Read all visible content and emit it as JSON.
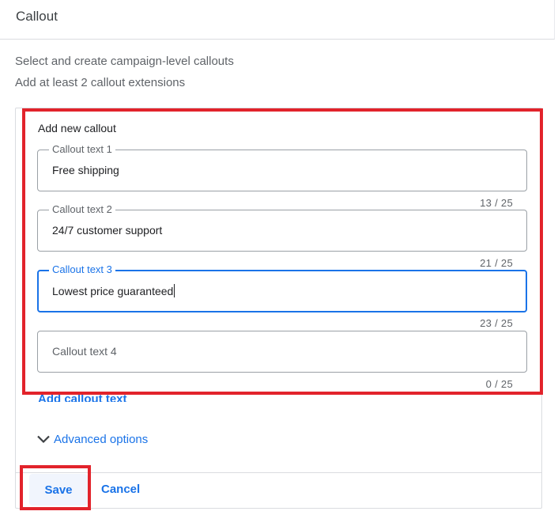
{
  "header": {
    "title": "Callout"
  },
  "description": {
    "line1": "Select and create campaign-level callouts",
    "line2": "Add at least 2 callout extensions"
  },
  "form": {
    "section_label": "Add new callout",
    "fields": [
      {
        "label": "Callout text 1",
        "value": "Free shipping",
        "counter": "13 / 25"
      },
      {
        "label": "Callout text 2",
        "value": "24/7 customer support",
        "counter": "21 / 25"
      },
      {
        "label": "Callout text 3",
        "value": "Lowest price guaranteed",
        "counter": "23 / 25",
        "focused": true
      },
      {
        "label": "",
        "placeholder": "Callout text 4",
        "value": "",
        "counter": "0 / 25"
      }
    ],
    "add_link": "Add callout text",
    "advanced_options": "Advanced options"
  },
  "actions": {
    "save": "Save",
    "cancel": "Cancel"
  },
  "colors": {
    "accent": "#1a73e8",
    "highlight": "#e2232b",
    "border": "#dadce0"
  },
  "icons": {
    "advanced_toggle": "chevron-down-icon"
  }
}
